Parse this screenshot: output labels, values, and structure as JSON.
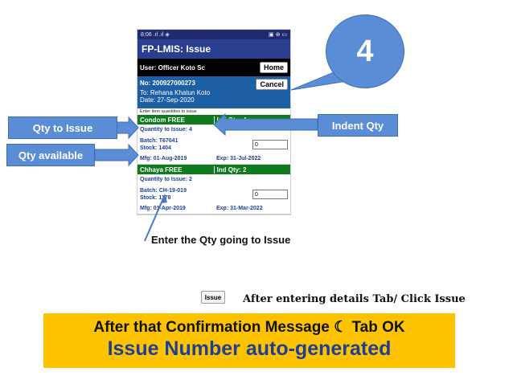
{
  "phone": {
    "status_left": "8:06 .⁠ıl ⁠.ıl ⁠◈",
    "status_right": "▣ ⊛ ▭",
    "title": "FP-LMIS: Issue",
    "user": "User: Officer Koto Sc",
    "home_label": "Home",
    "issue_no": "No: 200927000273",
    "cancel_label": "Cancel",
    "to": "To: Rehana Khatun Koto",
    "date": "Date: 27-Sep-2020",
    "enter_note": "Enter item quantities to issue",
    "items": [
      {
        "name": "Condom FREE",
        "ind_qty": "Ind Qty: 4",
        "qty_to_issue": "Quantity to Issue: 4",
        "batch": "Batch: T67041",
        "stock": "Stock: 1404",
        "input_value": "0",
        "mfg": "Mfg: 01-Aug-2019",
        "exp": "Exp: 31-Jul-2022"
      },
      {
        "name": "Chhaya FREE",
        "ind_qty": "Ind Qty: 2",
        "qty_to_issue": "Quantity to Issue: 2",
        "batch": "Batch: CH-19-019",
        "stock": "Stock: 1178",
        "input_value": "0",
        "mfg": "Mfg: 01-Apr-2019",
        "exp": "Exp: 31-Mar-2022"
      }
    ]
  },
  "callouts": {
    "step_number": "4",
    "qty_to_issue": "Qty to Issue",
    "qty_available": "Qty available",
    "indent_qty": "Indent Qty",
    "enter_qty": "Enter the Qty going to Issue",
    "issue_button": "Issue",
    "after_entering": "After entering details Tab/ Click Issue"
  },
  "banner": {
    "line1": "After that Confirmation Message  ☾  Tab OK",
    "line2": "Issue Number auto-generated"
  },
  "colors": {
    "callout_blue": "#5a8dd6",
    "banner_yellow": "#fdc300",
    "item_green": "#0f7a1e",
    "title_blue": "#2a3f8f"
  }
}
